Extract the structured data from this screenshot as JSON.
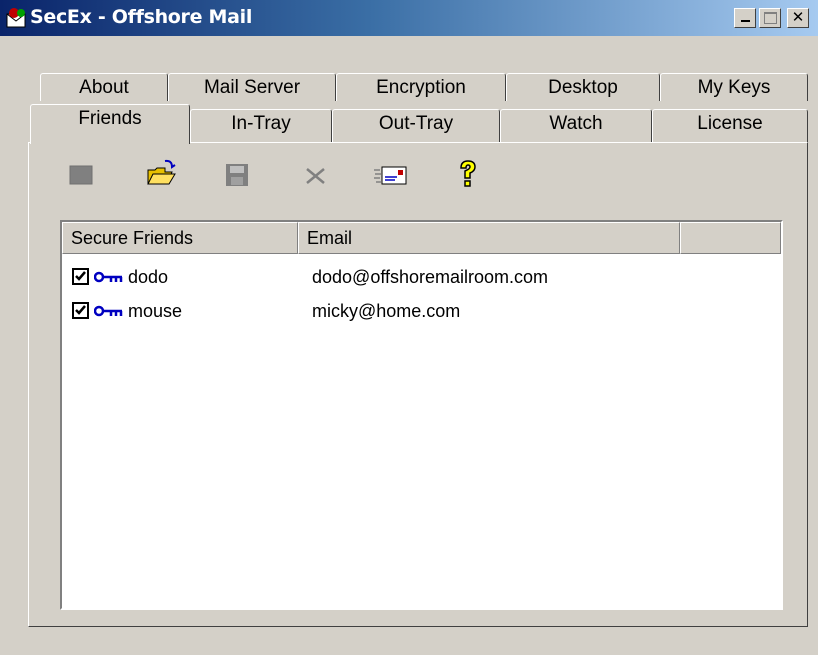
{
  "window": {
    "title": "SecEx - Offshore Mail",
    "title_bar_colors": [
      "#0a246a",
      "#a6caf0"
    ]
  },
  "tabs": {
    "row1": [
      {
        "label": "About"
      },
      {
        "label": "Mail Server"
      },
      {
        "label": "Encryption"
      },
      {
        "label": "Desktop"
      },
      {
        "label": "My Keys"
      }
    ],
    "row2": [
      {
        "label": "Friends",
        "active": true
      },
      {
        "label": "In-Tray"
      },
      {
        "label": "Out-Tray"
      },
      {
        "label": "Watch"
      },
      {
        "label": "License"
      }
    ]
  },
  "toolbar": {
    "icons": [
      "stop-icon",
      "open-folder-icon",
      "save-icon",
      "delete-icon",
      "email-card-icon",
      "help-icon"
    ]
  },
  "friends_list": {
    "columns": [
      "Secure Friends",
      "Email",
      ""
    ],
    "rows": [
      {
        "checked": true,
        "name": "dodo",
        "email": "dodo@offshoremailroom.com"
      },
      {
        "checked": true,
        "name": "mouse",
        "email": "micky@home.com"
      }
    ]
  },
  "colors": {
    "face": "#d4d0c8",
    "key_icon": "#0000c0",
    "folder_icon": "#e8c000",
    "help_icon": "#ffff00"
  }
}
